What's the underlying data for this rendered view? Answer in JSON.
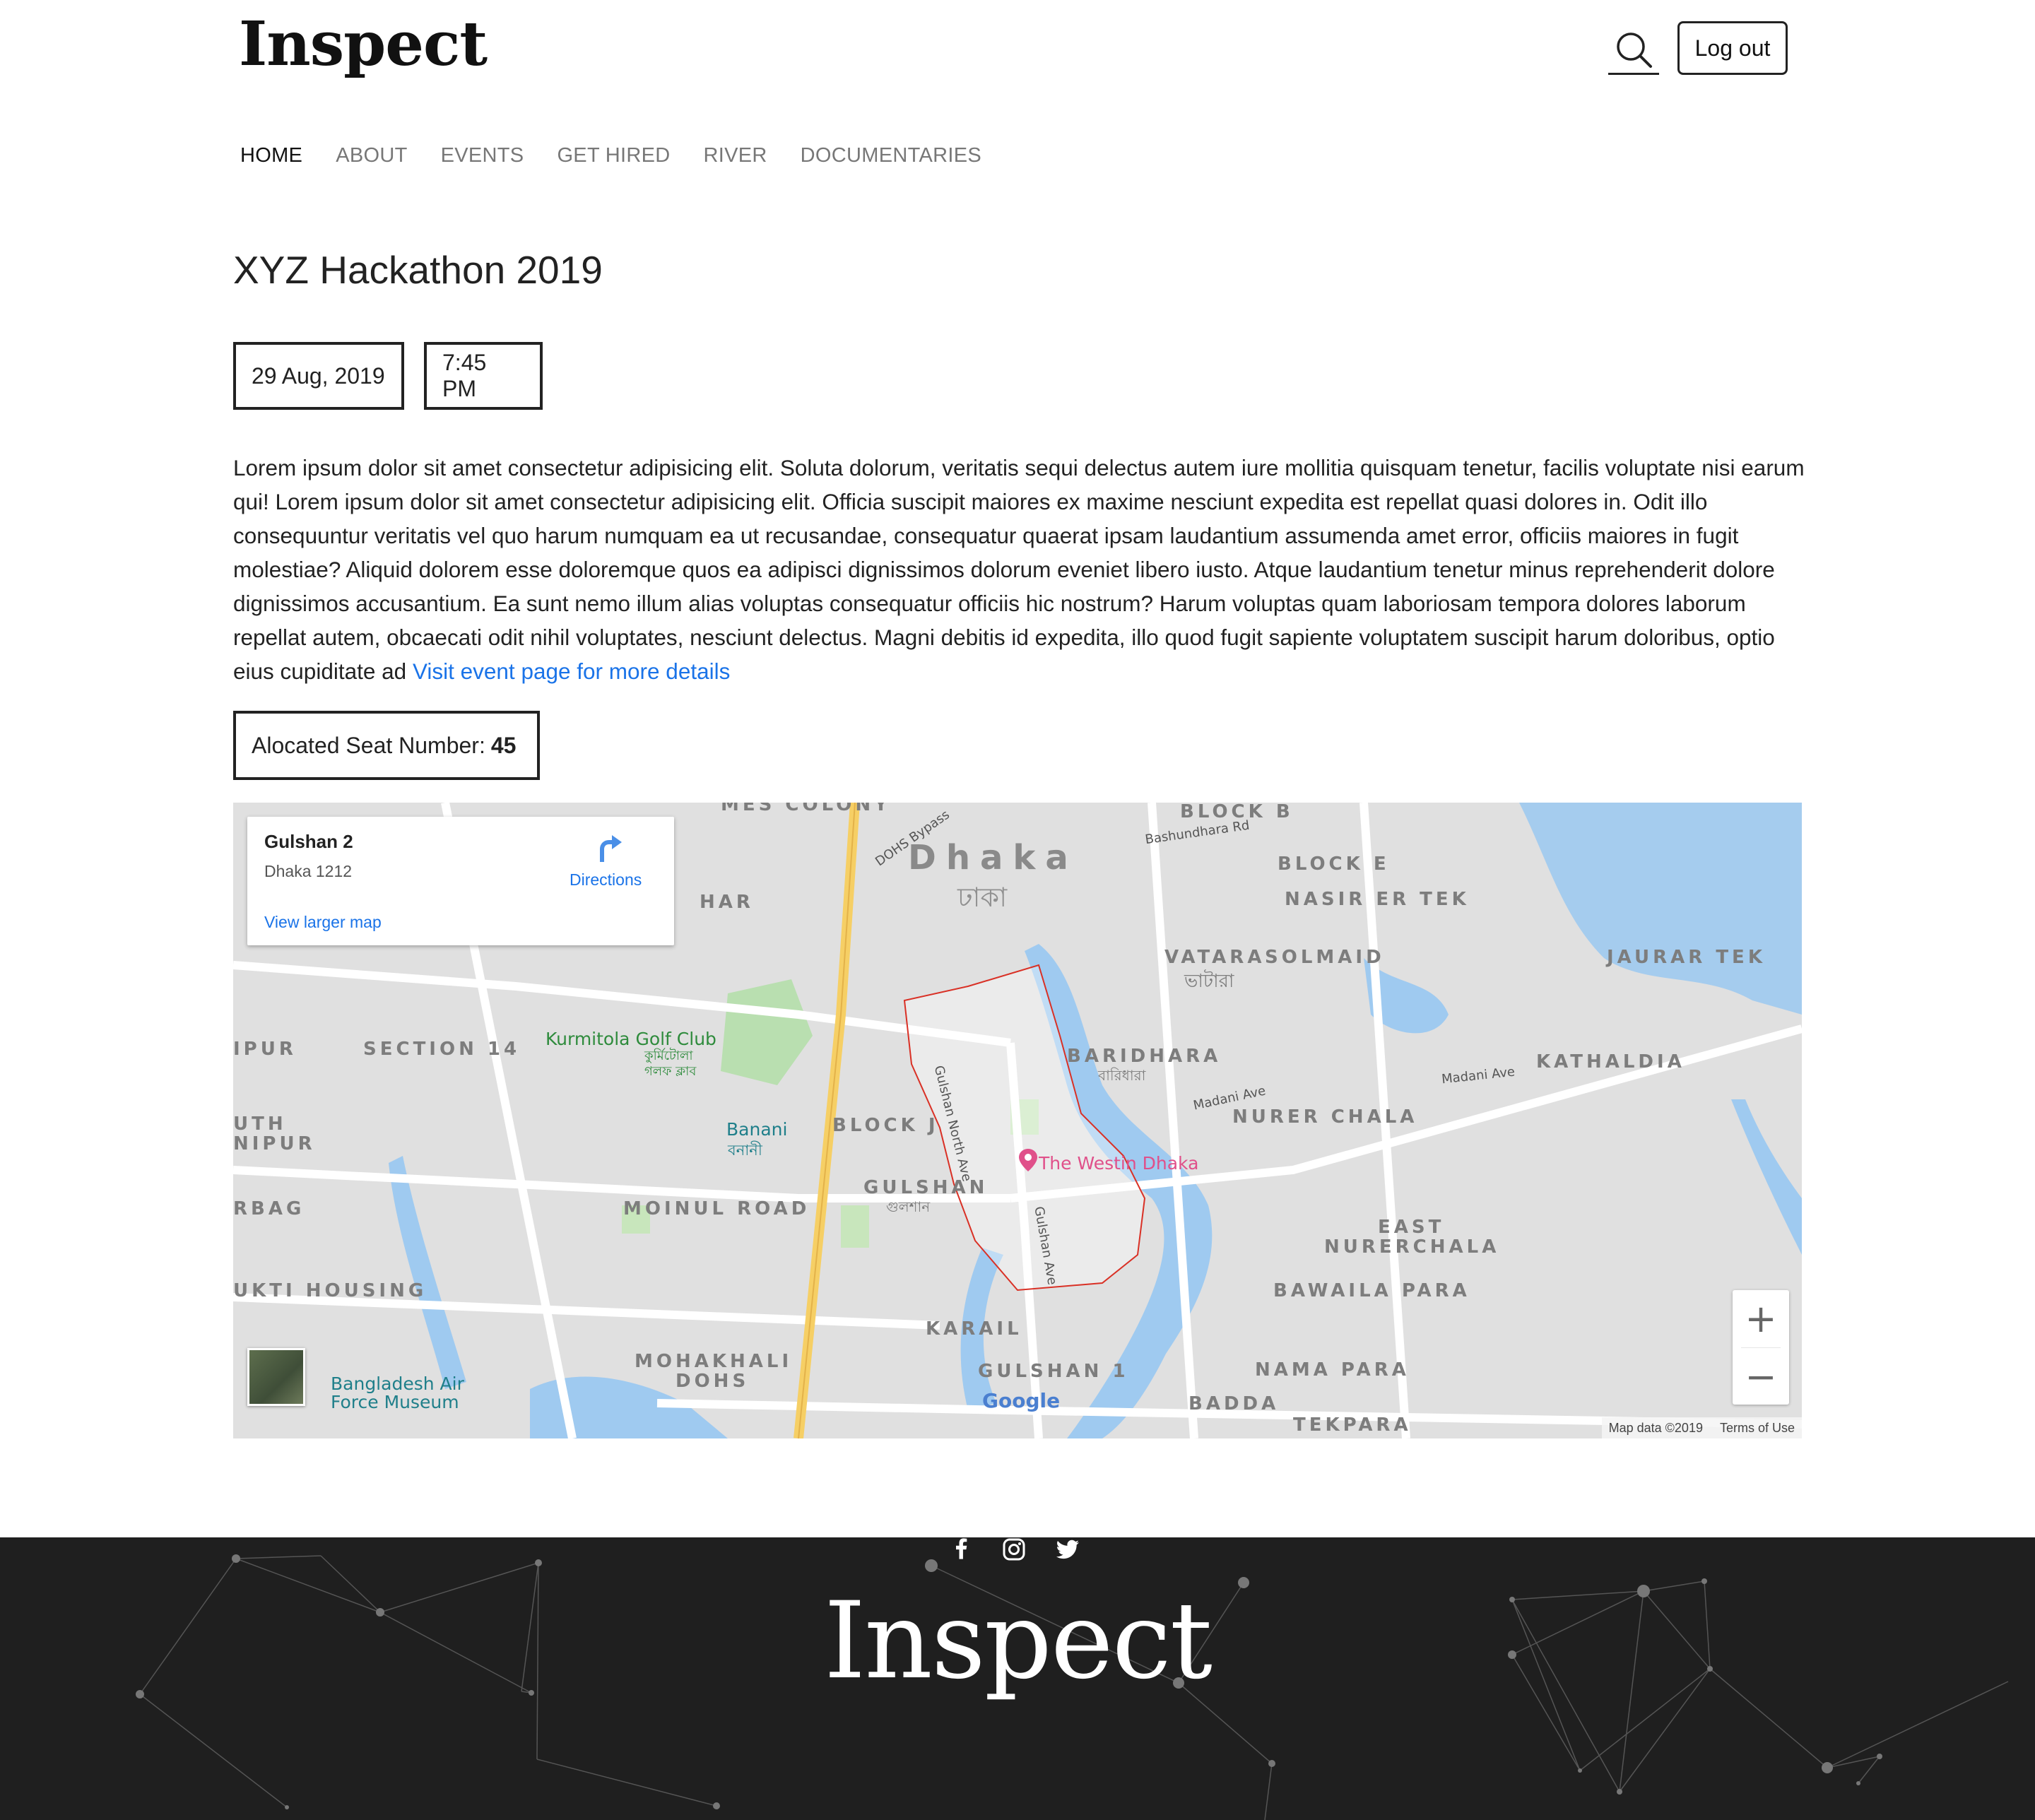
{
  "header": {
    "logo": "Inspect",
    "logout_label": "Log out"
  },
  "nav": {
    "items": [
      "HOME",
      "ABOUT",
      "EVENTS",
      "GET HIRED",
      "RIVER",
      "DOCUMENTARIES"
    ],
    "active": "HOME"
  },
  "event": {
    "title": "XYZ Hackathon 2019",
    "date": "29 Aug, 2019",
    "time": "7:45 PM",
    "description": "Lorem ipsum dolor sit amet consectetur adipisicing elit. Soluta dolorum, veritatis sequi delectus autem iure mollitia quisquam tenetur, facilis voluptate nisi earum qui! Lorem ipsum dolor sit amet consectetur adipisicing elit. Officia suscipit maiores ex maxime nesciunt expedita est repellat quasi dolores in. Odit illo consequuntur veritatis vel quo harum numquam ea ut recusandae, consequatur quaerat ipsam laudantium assumenda amet error, officiis maiores in fugit molestiae? Aliquid dolorem esse doloremque quos ea adipisci dignissimos dolorum eveniet libero iusto. Atque laudantium tenetur minus reprehenderit dolore dignissimos accusantium. Ea sunt nemo illum alias voluptas consequatur officiis hic nostrum? Harum voluptas quam laboriosam tempora dolores laborum repellat autem, obcaecati odit nihil voluptates, nesciunt delectus. Magni debitis id expedita, illo quod fugit sapiente voluptatem suscipit harum doloribus, optio eius cupiditate ad ",
    "event_link_label": "Visit event page for more details",
    "seat_label": "Alocated Seat Number:",
    "seat_number": "45"
  },
  "map": {
    "place_name": "Gulshan 2",
    "place_address": "Dhaka 1212",
    "directions_label": "Directions",
    "larger_map_label": "View larger map",
    "zoom_in": "+",
    "zoom_out": "−",
    "google_logo": "Google",
    "map_data": "Map data ©2019",
    "terms": "Terms of Use",
    "labels": {
      "dhaka": "Dhaka",
      "dhaka_bn": "ঢাকা",
      "mes_colony": "MES COLONY",
      "dohs_bypass": "DOHS Bypass",
      "block_b": "BLOCK B",
      "bashundhara": "Bashundhara Rd",
      "block_e": "BLOCK E",
      "nasir": "NASIR ER TEK",
      "jaurar": "JAURAR TEK",
      "vatara": "VATARA",
      "vatara_bn": "ভাটারা",
      "solmaid": "SOLMAID",
      "har": "HAR",
      "ipur": "IPUR",
      "section14": "SECTION 14",
      "kurmitola": "Kurmitola Golf Club",
      "kurmitola_bn": "কুর্মিটোলা গলফ ক্লাব",
      "baridhara": "BARIDHARA",
      "baridhara_bn": "বারিধারা",
      "madani": "Madani Ave",
      "madani2": "Madani Ave",
      "kathaldia": "KATHALDIA",
      "nurer": "NURER CHALA",
      "uth": "UTH",
      "nipur": "NIPUR",
      "banani": "Banani",
      "banani_bn": "বনানী",
      "block_j": "BLOCK J",
      "westin": "The Westin Dhaka",
      "gulshan_north": "Gulshan North Ave",
      "gulshan_ave": "Gulshan Ave",
      "rbag": "RBAG",
      "gulshan": "GULSHAN",
      "gulshan_bn": "গুলশান",
      "moinul": "MOINUL ROAD",
      "east": "EAST",
      "nurerchala": "NURERCHALA",
      "bawaila": "BAWAILA PARA",
      "mukti": "UKTI HOUSING",
      "karail": "KARAIL",
      "mohakhali": "MOHAKHALI",
      "dohs": "DOHS",
      "gulshan1": "GULSHAN 1",
      "nama": "NAMA PARA",
      "badda": "BADDA",
      "tekpara": "TEKPARA",
      "bafm1": "Bangladesh Air",
      "bafm2": "Force Museum"
    }
  },
  "footer": {
    "logo": "Inspect",
    "social": [
      "facebook-icon",
      "instagram-icon",
      "twitter-icon"
    ]
  },
  "colors": {
    "link": "#1a73e8",
    "footer_bg": "#1f1f1f",
    "map_bg": "#e5e3df",
    "water": "#9fcaf0",
    "boundary": "#d93025"
  }
}
